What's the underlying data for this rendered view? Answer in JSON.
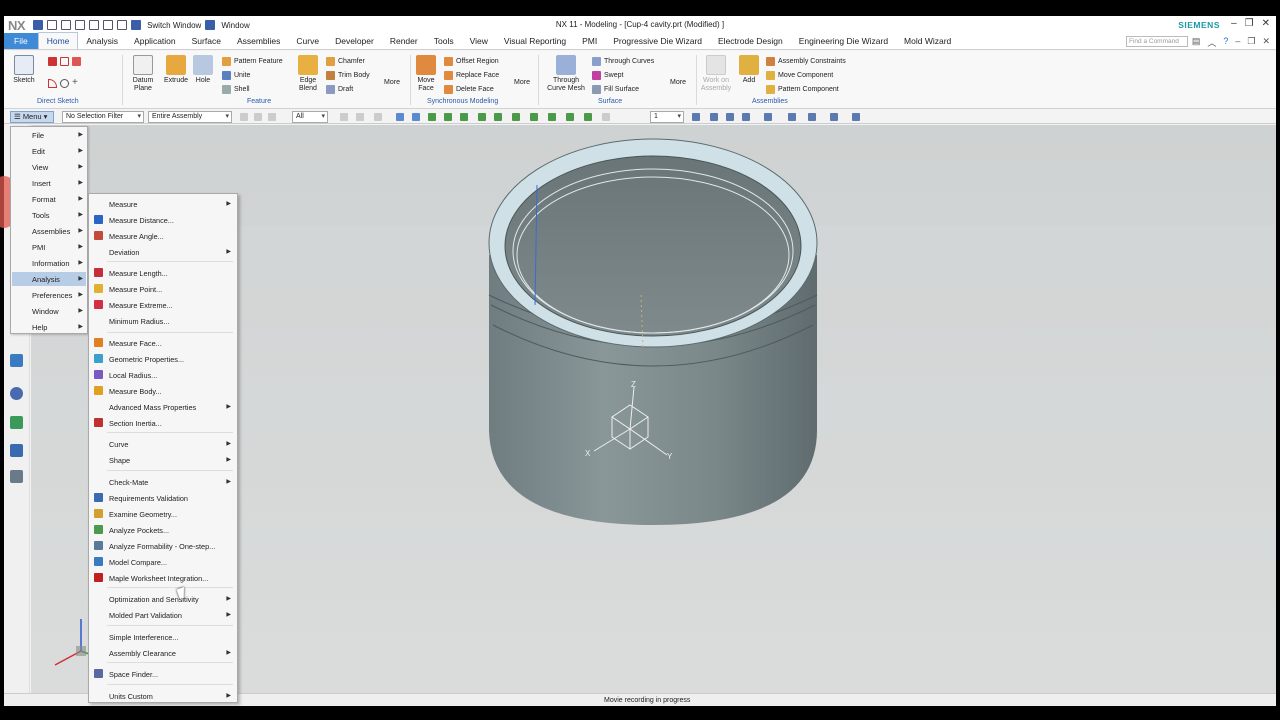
{
  "titlebar": {
    "logo": "NX",
    "switch_window": "Switch Window",
    "window": "Window",
    "title": "NX 11 - Modeling - [Cup-4 cavity.prt (Modified) ]",
    "brand": "SIEMENS"
  },
  "tabs": [
    "File",
    "Home",
    "Analysis",
    "Application",
    "Surface",
    "Assemblies",
    "Curve",
    "Developer",
    "Render",
    "Tools",
    "View",
    "Visual Reporting",
    "PMI",
    "Progressive Die Wizard",
    "Electrode Design",
    "Engineering Die Wizard",
    "Mold Wizard"
  ],
  "find_placeholder": "Find a Command",
  "ribbon": {
    "sketch": "Sketch",
    "direct_sketch": "Direct Sketch",
    "datum_plane": "Datum Plane",
    "extrude": "Extrude",
    "hole": "Hole",
    "pattern_feature": "Pattern Feature",
    "unite": "Unite",
    "shell": "Shell",
    "edge_blend": "Edge Blend",
    "chamfer": "Chamfer",
    "trim_body": "Trim Body",
    "draft": "Draft",
    "more1": "More",
    "feature": "Feature",
    "move_face": "Move Face",
    "offset_region": "Offset Region",
    "replace_face": "Replace Face",
    "delete_face": "Delete Face",
    "more2": "More",
    "synchronous_modeling": "Synchronous Modeling",
    "through_curve_mesh": "Through Curve Mesh",
    "through_curves": "Through Curves",
    "swept": "Swept",
    "fill_surface": "Fill Surface",
    "more3": "More",
    "surface": "Surface",
    "work_on_assembly": "Work on Assembly",
    "add": "Add",
    "assembly_constraints": "Assembly Constraints",
    "move_component": "Move Component",
    "pattern_component": "Pattern Component",
    "assemblies": "Assemblies"
  },
  "toolbar": {
    "menu": "Menu",
    "selection_filter": "No Selection Filter",
    "assembly_scope": "Entire Assembly",
    "all": "All",
    "count": "1"
  },
  "main_menu": [
    "File",
    "Edit",
    "View",
    "Insert",
    "Format",
    "Tools",
    "Assemblies",
    "PMI",
    "Information",
    "Analysis",
    "Preferences",
    "Window",
    "Help"
  ],
  "analysis_menu": [
    {
      "label": "Measure",
      "arrow": true
    },
    {
      "label": "Measure Distance...",
      "icon": "#2c64c4"
    },
    {
      "label": "Measure Angle...",
      "icon": "#c44a3a"
    },
    {
      "label": "Deviation",
      "arrow": true
    },
    {
      "label": "Measure Length...",
      "icon": "#c4303a"
    },
    {
      "label": "Measure Point...",
      "icon": "#e0b030"
    },
    {
      "label": "Measure Extreme...",
      "icon": "#d03040"
    },
    {
      "label": "Minimum Radius..."
    },
    {
      "label": "Measure Face...",
      "icon": "#e08020"
    },
    {
      "label": "Geometric Properties...",
      "icon": "#3aa0d0"
    },
    {
      "label": "Local Radius...",
      "icon": "#7a5ac0"
    },
    {
      "label": "Measure Body...",
      "icon": "#e0a020"
    },
    {
      "label": "Advanced Mass Properties",
      "arrow": true
    },
    {
      "label": "Section Inertia...",
      "icon": "#c03030"
    },
    {
      "label": "Curve",
      "arrow": true
    },
    {
      "label": "Shape",
      "arrow": true
    },
    {
      "label": "Check-Mate",
      "arrow": true
    },
    {
      "label": "Requirements Validation",
      "icon": "#3a6ab0"
    },
    {
      "label": "Examine Geometry...",
      "icon": "#d0a030"
    },
    {
      "label": "Analyze Pockets...",
      "icon": "#4a9a50"
    },
    {
      "label": "Analyze Formability - One-step...",
      "icon": "#5a7a9a"
    },
    {
      "label": "Model Compare...",
      "icon": "#3a7ac0"
    },
    {
      "label": "Maple Worksheet Integration...",
      "icon": "#c02020"
    },
    {
      "label": "Optimization and Sensitivity",
      "arrow": true
    },
    {
      "label": "Molded Part Validation",
      "arrow": true
    },
    {
      "label": "Simple Interference..."
    },
    {
      "label": "Assembly Clearance",
      "arrow": true
    },
    {
      "label": "Space Finder...",
      "icon": "#5a6aa0"
    },
    {
      "label": "Units Custom",
      "arrow": true
    }
  ],
  "model": {
    "axis_x": "X",
    "axis_y": "Y",
    "axis_z": "Z"
  },
  "status": {
    "text": "Movie recording in progress"
  }
}
